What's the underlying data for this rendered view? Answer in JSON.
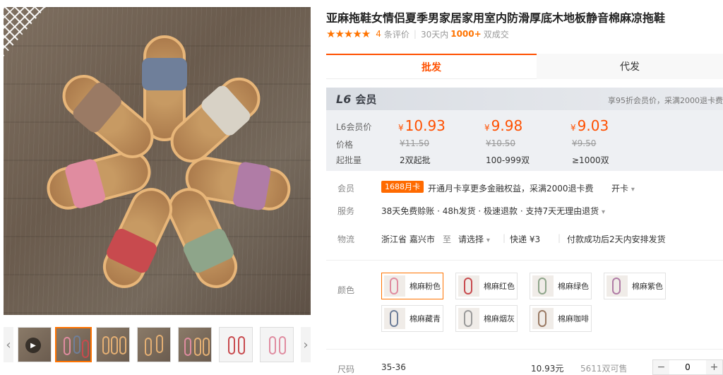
{
  "product": {
    "title": "亚麻拖鞋女情侣夏季男家居家用室内防滑厚底木地板静音棉麻凉拖鞋",
    "rating_count": "4",
    "rating_unit": "条评价",
    "sales_prefix": "30天内",
    "sales_num": "1000+",
    "sales_suffix": "双成交"
  },
  "tabs": {
    "wholesale": "批发",
    "dropship": "代发"
  },
  "member_box": {
    "level": "L6",
    "label": "会员",
    "note": "享95折会员价，采满2000退卡费",
    "row_member_price": "L6会员价",
    "row_price": "价格",
    "row_min": "起批量",
    "currency": "¥",
    "tiers": [
      {
        "member_price": "10.93",
        "price": "¥11.50",
        "qty": "2双起批"
      },
      {
        "member_price": "9.98",
        "price": "¥10.50",
        "qty": "100-999双"
      },
      {
        "member_price": "9.03",
        "price": "¥9.50",
        "qty": "≥1000双"
      }
    ]
  },
  "info": {
    "member_label": "会员",
    "member_badge": "1688月卡",
    "member_text": "开通月卡享更多金融权益，采满2000退卡费",
    "member_action": "开卡",
    "service_label": "服务",
    "service_text": "38天免费赊账 · 48h发货 · 极速退款 · 支持7天无理由退货",
    "logistics_label": "物流",
    "origin": "浙江省 嘉兴市",
    "to": "至",
    "dest": "请选择",
    "shipping": "快递 ¥3",
    "ship_note": "付款成功后2天内安排发货"
  },
  "color": {
    "label": "颜色",
    "options": [
      "棉麻粉色",
      "棉麻红色",
      "棉麻绿色",
      "棉麻紫色",
      "棉麻藏青",
      "棉麻烟灰",
      "棉麻咖啡"
    ],
    "selected": "棉麻粉色"
  },
  "size": {
    "label": "尺码",
    "value": "35-36",
    "price": "10.93元",
    "stock": "5611双可售",
    "quantity": "0"
  },
  "colors": {
    "accent": "#ff5000",
    "accent2": "#ff7300",
    "badge": "#ff6a00"
  },
  "icons": {
    "prev": "chevron-left-icon",
    "next": "chevron-right-icon",
    "play": "play-icon",
    "star": "star-icon"
  }
}
